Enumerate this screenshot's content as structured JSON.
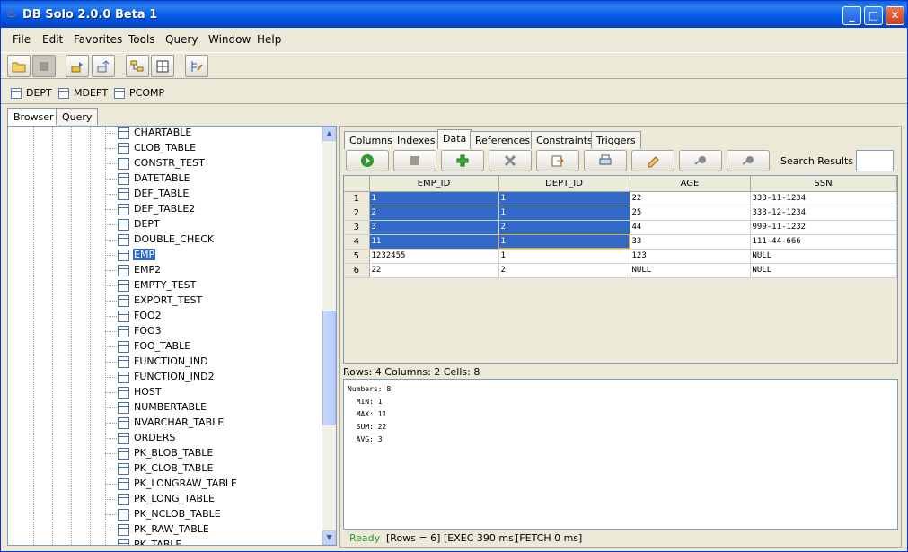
{
  "window": {
    "title": "DB Solo  2.0.0 Beta 1",
    "buttons": {
      "minimize": "_",
      "maximize": "□",
      "close": "✕"
    }
  },
  "menubar": [
    "File",
    "Edit",
    "Favorites",
    "Tools",
    "Query",
    "Window",
    "Help"
  ],
  "toolbar_icons": [
    "open-folder-icon",
    "stop-icon",
    "connect-icon",
    "disconnect-icon",
    "schema-tree-icon",
    "grid-icon",
    "query-edit-icon"
  ],
  "favorites": [
    "DEPT",
    "MDEPT",
    "PCOMP"
  ],
  "left_tabs": [
    "Browser",
    "Query"
  ],
  "tree": {
    "items": [
      "CHARTABLE",
      "CLOB_TABLE",
      "CONSTR_TEST",
      "DATETABLE",
      "DEF_TABLE",
      "DEF_TABLE2",
      "DEPT",
      "DOUBLE_CHECK",
      "EMP",
      "EMP2",
      "EMPTY_TEST",
      "EXPORT_TEST",
      "FOO2",
      "FOO3",
      "FOO_TABLE",
      "FUNCTION_IND",
      "FUNCTION_IND2",
      "HOST",
      "NUMBERTABLE",
      "NVARCHAR_TABLE",
      "ORDERS",
      "PK_BLOB_TABLE",
      "PK_CLOB_TABLE",
      "PK_LONGRAW_TABLE",
      "PK_LONG_TABLE",
      "PK_NCLOB_TABLE",
      "PK_RAW_TABLE",
      "PK_TABLE"
    ],
    "selected": "EMP"
  },
  "right_tabs": [
    "Columns",
    "Indexes",
    "Data",
    "References",
    "Constraints",
    "Triggers"
  ],
  "active_right_tab": "Data",
  "data_toolbar": {
    "search_label": "Search Results",
    "search_value": ""
  },
  "grid": {
    "columns": [
      "EMP_ID",
      "DEPT_ID",
      "AGE",
      "SSN"
    ],
    "rows": [
      [
        "1",
        "1",
        "1",
        "22",
        "333-11-1234"
      ],
      [
        "2",
        "2",
        "1",
        "25",
        "333-12-1234"
      ],
      [
        "3",
        "3",
        "2",
        "44",
        "999-11-1232"
      ],
      [
        "4",
        "11",
        "1",
        "33",
        "111-44-666"
      ],
      [
        "5",
        "1232455",
        "1",
        "123",
        "NULL"
      ],
      [
        "6",
        "22",
        "2",
        "NULL",
        "NULL"
      ]
    ]
  },
  "selection_summary": "Rows: 4 Columns: 2 Cells: 8",
  "stats_text": "Numbers: 8\n  MIN: 1\n  MAX: 11\n  SUM: 22\n  AVG: 3",
  "status": {
    "ready": "Ready",
    "rows": "[Rows = 6]",
    "exec": "[EXEC 390 ms]",
    "fetch": "[FETCH 0 ms]"
  },
  "colors": {
    "title_bar": "#0058e6",
    "selection": "#316ac5",
    "ready_green": "#2a9a2a"
  }
}
